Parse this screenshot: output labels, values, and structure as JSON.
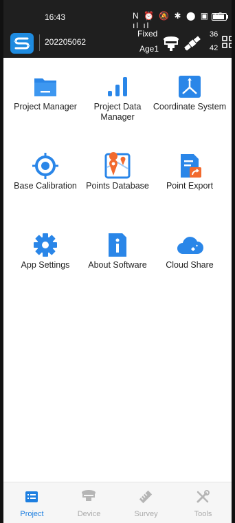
{
  "status_bar": {
    "time": "16:43",
    "icons_text": "N ⏰ 🔕 ✱ ⬤ ▣ ⁴ᴳ ıl ıl"
  },
  "header": {
    "device_id": "202205062",
    "fix_status": "Fixed",
    "age_label": "Age1",
    "satellites": "36",
    "age_value": "42",
    "colors": {
      "background": "#1f1f1f",
      "logo": "#1e8be0"
    }
  },
  "modules": [
    {
      "label": "Project Manager",
      "icon": "folder-icon"
    },
    {
      "label": "Project Data Manager",
      "icon": "bar-chart-icon"
    },
    {
      "label": "Coordinate System",
      "icon": "coordinate-axes-icon"
    },
    {
      "label": "Base Calibration",
      "icon": "crosshair-icon"
    },
    {
      "label": "Points Database",
      "icon": "map-pin-icon"
    },
    {
      "label": "Point Export",
      "icon": "document-export-icon"
    },
    {
      "label": "App Settings",
      "icon": "gear-icon"
    },
    {
      "label": "About Software",
      "icon": "info-icon"
    },
    {
      "label": "Cloud Share",
      "icon": "cloud-icon"
    }
  ],
  "bottom_nav": [
    {
      "label": "Project",
      "icon": "list-icon",
      "active": true
    },
    {
      "label": "Device",
      "icon": "receiver-icon",
      "active": false
    },
    {
      "label": "Survey",
      "icon": "ruler-icon",
      "active": false
    },
    {
      "label": "Tools",
      "icon": "tools-icon",
      "active": false
    }
  ],
  "colors": {
    "accent": "#1e7fe0",
    "icon_blue": "#2a86e8",
    "icon_orange": "#f26a2e",
    "inactive": "#aaaaaa"
  }
}
